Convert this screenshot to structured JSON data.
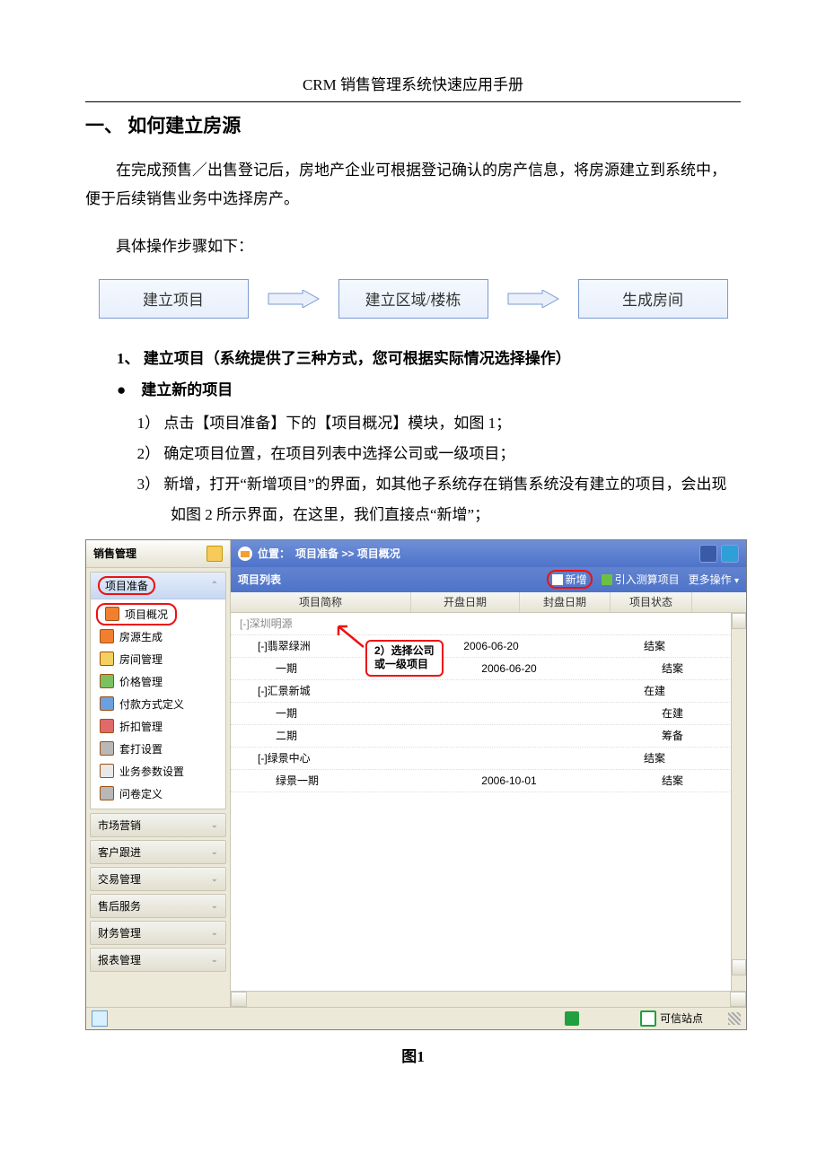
{
  "header": {
    "title": "CRM 销售管理系统快速应用手册"
  },
  "section": {
    "h1": "一、 如何建立房源",
    "intro": "在完成预售／出售登记后，房地产企业可根据登记确认的房产信息，将房源建立到系统中，便于后续销售业务中选择房产。",
    "steps_intro": "具体操作步骤如下：",
    "flow": {
      "box1": "建立项目",
      "box2": "建立区域/楼栋",
      "box3": "生成房间"
    },
    "num1": "1、 建立项目（系统提供了三种方式，您可根据实际情况选择操作）",
    "bullet1": "● 建立新的项目",
    "sub1": "1） 点击【项目准备】下的【项目概况】模块，如图 1；",
    "sub2": "2） 确定项目位置，在项目列表中选择公司或一级项目；",
    "sub3": "3） 新增，打开“新增项目”的界面，如其他子系统存在销售系统没有建立的项目，会出现如图 2 所示界面，在这里，我们直接点“新增”；"
  },
  "screenshot": {
    "left_title": "销售管理",
    "nav_block_title": "项目准备",
    "nav_selected": "项目概况",
    "nav_items": [
      "房源生成",
      "房间管理",
      "价格管理",
      "付款方式定义",
      "折扣管理",
      "套打设置",
      "业务参数设置",
      "问卷定义"
    ],
    "groups": [
      "市场营销",
      "客户跟进",
      "交易管理",
      "售后服务",
      "财务管理",
      "报表管理"
    ],
    "topbar_prefix": "位置：",
    "topbar_path": "项目准备 >> 项目概况",
    "toolbar_title": "项目列表",
    "btn_new": "新增",
    "btn_import": "引入测算项目",
    "btn_more": "更多操作",
    "columns": {
      "c1": "项目简称",
      "c2": "开盘日期",
      "c3": "封盘日期",
      "c4": "项目状态"
    },
    "rows": [
      {
        "name": "[-]深圳明源",
        "lvl": 0,
        "root": true
      },
      {
        "name": "[-]翡翠绿洲",
        "date": "2006-06-20",
        "status": "结案",
        "lvl": 1
      },
      {
        "name": "一期",
        "date": "2006-06-20",
        "status": "结案",
        "lvl": 2
      },
      {
        "name": "[-]汇景新城",
        "status": "在建",
        "lvl": 1
      },
      {
        "name": "一期",
        "status": "在建",
        "lvl": 2
      },
      {
        "name": "二期",
        "status": "筹备",
        "lvl": 2
      },
      {
        "name": "[-]绿景中心",
        "status": "结案",
        "lvl": 1
      },
      {
        "name": "绿景一期",
        "date": "2006-10-01",
        "status": "结案",
        "lvl": 2
      }
    ],
    "callout": "2）选择公司\n或一级项目",
    "status_trusted": "可信站点"
  },
  "caption": "图1"
}
